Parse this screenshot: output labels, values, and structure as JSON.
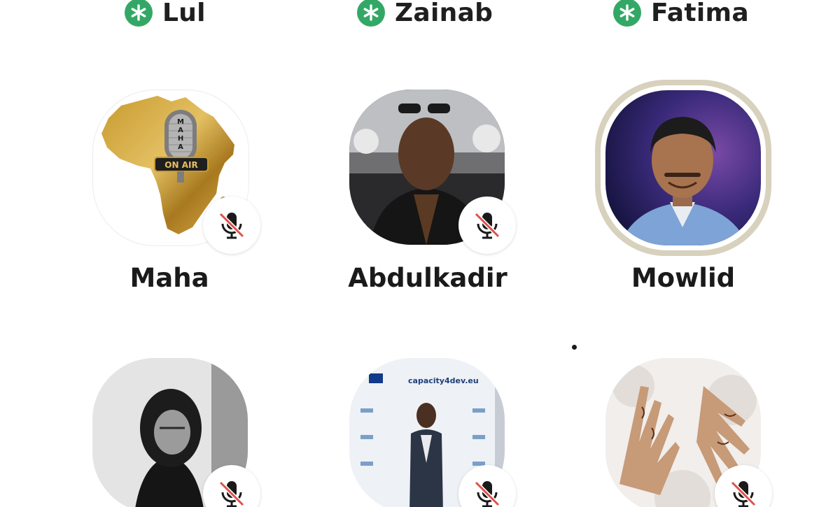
{
  "moderators": [
    {
      "name": "Lul",
      "badge_icon": "asterisk-icon"
    },
    {
      "name": "Zainab",
      "badge_icon": "asterisk-icon"
    },
    {
      "name": "Fatima",
      "badge_icon": "asterisk-icon"
    }
  ],
  "speakers_row1": [
    {
      "name": "Maha",
      "muted": true,
      "avatar_text_top": "MAHA",
      "avatar_text_mid": "ON AIR"
    },
    {
      "name": "Abdulkadir",
      "muted": true
    },
    {
      "name": "Mowlid",
      "muted": false,
      "speaking": true
    }
  ],
  "speakers_row2": [
    {
      "muted": true
    },
    {
      "muted": true,
      "banner_text": "capacity4dev.eu"
    },
    {
      "muted": true
    }
  ],
  "colors": {
    "moderator_badge": "#33a866",
    "mute_slash": "#e0504a",
    "speaking_ring": "#d7d1bd"
  }
}
